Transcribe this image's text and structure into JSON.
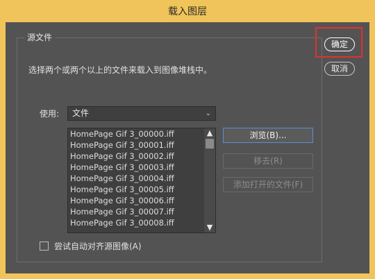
{
  "window": {
    "title": "载入图层"
  },
  "source_group": {
    "label": "源文件",
    "description": "选择两个或两个以上的文件来载入到图像堆栈中。",
    "use_label": "使用:",
    "use_selected": "文件",
    "files": [
      "HomePage Gif 3_00000.iff",
      "HomePage Gif 3_00001.iff",
      "HomePage Gif 3_00002.iff",
      "HomePage Gif 3_00003.iff",
      "HomePage Gif 3_00004.iff",
      "HomePage Gif 3_00005.iff",
      "HomePage Gif 3_00006.iff",
      "HomePage Gif 3_00007.iff",
      "HomePage Gif 3_00008.iff"
    ],
    "buttons": {
      "browse": "浏览(B)...",
      "remove": "移去(R)",
      "add_open": "添加打开的文件(F)"
    },
    "auto_align": {
      "label": "尝试自动对齐源图像(A)",
      "checked": false
    }
  },
  "actions": {
    "ok": "确定",
    "cancel": "取消"
  },
  "colors": {
    "background": "#535353",
    "title_bar": "#f0c45a",
    "highlight": "#e23232",
    "focus": "#5b8fd4"
  }
}
